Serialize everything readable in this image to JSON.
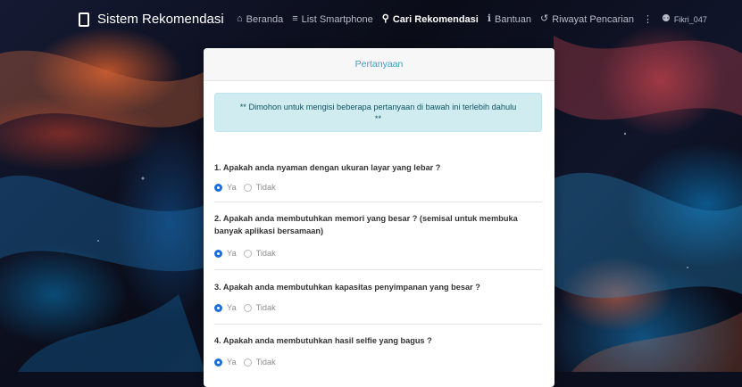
{
  "navbar": {
    "brand": "Sistem Rekomendasi",
    "items": [
      {
        "icon": "home-icon",
        "glyph": "⌂",
        "label": "Beranda"
      },
      {
        "icon": "list-icon",
        "glyph": "≡",
        "label": "List Smartphone"
      },
      {
        "icon": "search-icon",
        "glyph": "⚲",
        "label": "Cari Rekomendasi"
      },
      {
        "icon": "info-icon",
        "glyph": "ℹ",
        "label": "Bantuan"
      },
      {
        "icon": "history-icon",
        "glyph": "↺",
        "label": "Riwayat Pencarian"
      },
      {
        "icon": "user-icon",
        "glyph": "⚉",
        "label": "Fikri_047"
      }
    ]
  },
  "card": {
    "header": "Pertanyaan",
    "alert_line1": "** Dimohon untuk mengisi beberapa pertanyaan di bawah ini terlebih dahulu",
    "alert_line2": "**",
    "option_yes": "Ya",
    "option_no": "Tidak",
    "questions": [
      {
        "text": "1. Apakah anda nyaman dengan ukuran layar yang lebar ?",
        "selected": "Ya"
      },
      {
        "text": "2. Apakah anda membutuhkan memori yang besar ? (semisal untuk membuka banyak aplikasi bersamaan)",
        "selected": "Ya"
      },
      {
        "text": "3. Apakah anda membutuhkan kapasitas penyimpanan yang besar ?",
        "selected": "Ya"
      },
      {
        "text": "4. Apakah anda membutuhkan hasil selfie yang bagus ?",
        "selected": "Ya"
      }
    ]
  },
  "colors": {
    "accent": "#3ba1c4",
    "radio_checked": "#1a6fe0",
    "alert_bg": "#d1ecf1",
    "alert_text": "#0c5460"
  }
}
